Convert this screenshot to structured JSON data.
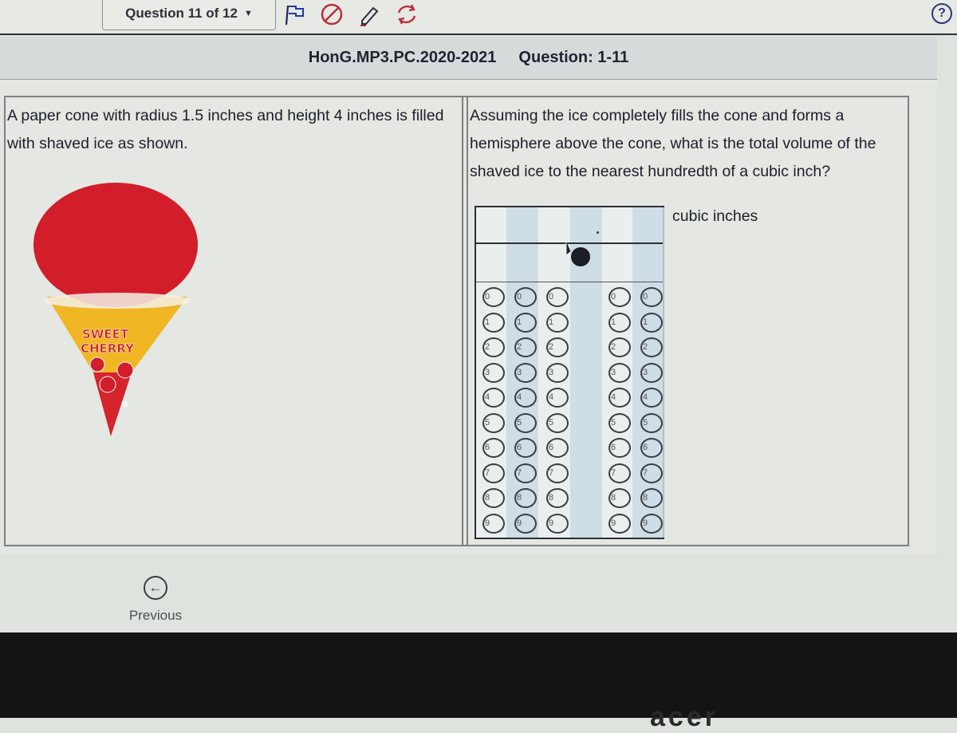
{
  "topbar": {
    "question_selector": "Question 11 of 12",
    "tools": [
      {
        "name": "flag-icon",
        "color": "#2336a8"
      },
      {
        "name": "eliminator-icon",
        "color": "#b82f3b"
      },
      {
        "name": "pencil-icon",
        "color": "#b82f3b"
      },
      {
        "name": "reset-icon",
        "color": "#b82f3b"
      }
    ],
    "help_label": "?"
  },
  "header": {
    "test_name": "HonG.MP3.PC.2020-2021",
    "question_label": "Question: 1-11"
  },
  "question": {
    "left_text": "A paper cone with radius 1.5 inches and height 4 inches is filled with shaved ice as shown.",
    "right_text": "Assuming the ice completely fills the cone and forms a hemisphere above the cone, what is the total volume of the shaved ice to the nearest hundredth of a cubic inch?",
    "image": {
      "label_line1": "SWEET",
      "label_line2": "CHERRY",
      "colors": {
        "ice": "#d21e2a",
        "cone_top": "#f0b623",
        "cone_bottom": "#d5242c"
      }
    }
  },
  "answer_grid": {
    "unit_label": "cubic inches",
    "columns": [
      {
        "type": "digit",
        "entry": ""
      },
      {
        "type": "digit",
        "entry": ""
      },
      {
        "type": "digit",
        "entry": ""
      },
      {
        "type": "decimal",
        "entry": "."
      },
      {
        "type": "digit",
        "entry": ""
      },
      {
        "type": "digit",
        "entry": ""
      }
    ],
    "digits": [
      "0",
      "1",
      "2",
      "3",
      "4",
      "5",
      "6",
      "7",
      "8",
      "9"
    ],
    "selected": []
  },
  "navigation": {
    "previous_label": "Previous"
  },
  "bezel": {
    "brand": "acer"
  }
}
